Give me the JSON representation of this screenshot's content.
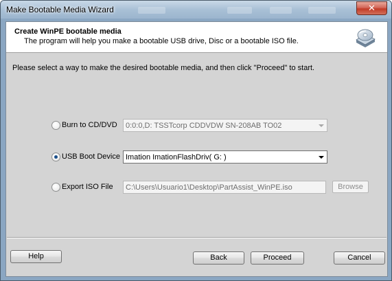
{
  "window": {
    "title": "Make Bootable Media Wizard",
    "close_glyph": "✕"
  },
  "header": {
    "title": "Create WinPE bootable media",
    "subtitle": "The program will help you make a bootable USB drive, Disc or a bootable ISO file.",
    "icon": "disc-icon"
  },
  "instruction": "Please select a way to make the desired bootable media, and then click \"Proceed\" to start.",
  "options": {
    "burn": {
      "label": "Burn to CD/DVD",
      "checked": false,
      "device": "0:0:0,D: TSSTcorp CDDVDW SN-208AB  TO02"
    },
    "usb": {
      "label": "USB Boot Device",
      "checked": true,
      "device": "Imation ImationFlashDriv( G: )"
    },
    "iso": {
      "label": "Export ISO File",
      "checked": false,
      "path": "C:\\Users\\Usuario1\\Desktop\\PartAssist_WinPE.iso",
      "browse_label": "Browse"
    }
  },
  "footer": {
    "help_label": "Help",
    "back_label": "Back",
    "proceed_label": "Proceed",
    "cancel_label": "Cancel"
  },
  "colors": {
    "frame": "#8aa6c2",
    "client_bg": "#d4d4d4",
    "header_bg": "#ffffff",
    "close_red": "#c23c28",
    "radio_dot": "#1b4f8a"
  }
}
